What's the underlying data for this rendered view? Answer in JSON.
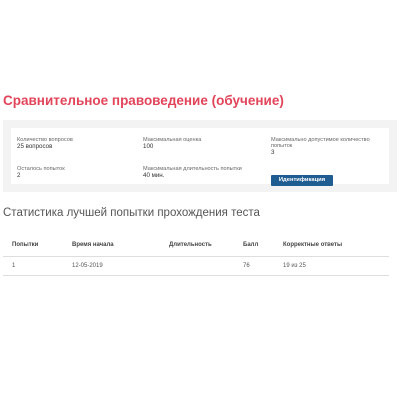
{
  "page": {
    "title": "Сравнительное правоведение (обучение)"
  },
  "info": {
    "question_count_label": "Количество вопросов",
    "question_count_value": "25 вопросов",
    "max_score_label": "Максимальная оценка",
    "max_score_value": "100",
    "max_attempts_label": "Максимально допустимое количество попыток",
    "max_attempts_value": "3",
    "attempts_left_label": "Осталось попыток",
    "attempts_left_value": "2",
    "max_duration_label": "Максимальная длительность попытки",
    "max_duration_value": "40 мин.",
    "identify_button": "Идентификация"
  },
  "stats": {
    "title": "Статистика лучшей попытки прохождения теста",
    "columns": [
      "Попытки",
      "Время начала",
      "Длительность",
      "Балл",
      "Корректные ответы"
    ],
    "rows": [
      [
        "1",
        "12-05-2019",
        "",
        "76",
        "19 из 25"
      ]
    ]
  }
}
